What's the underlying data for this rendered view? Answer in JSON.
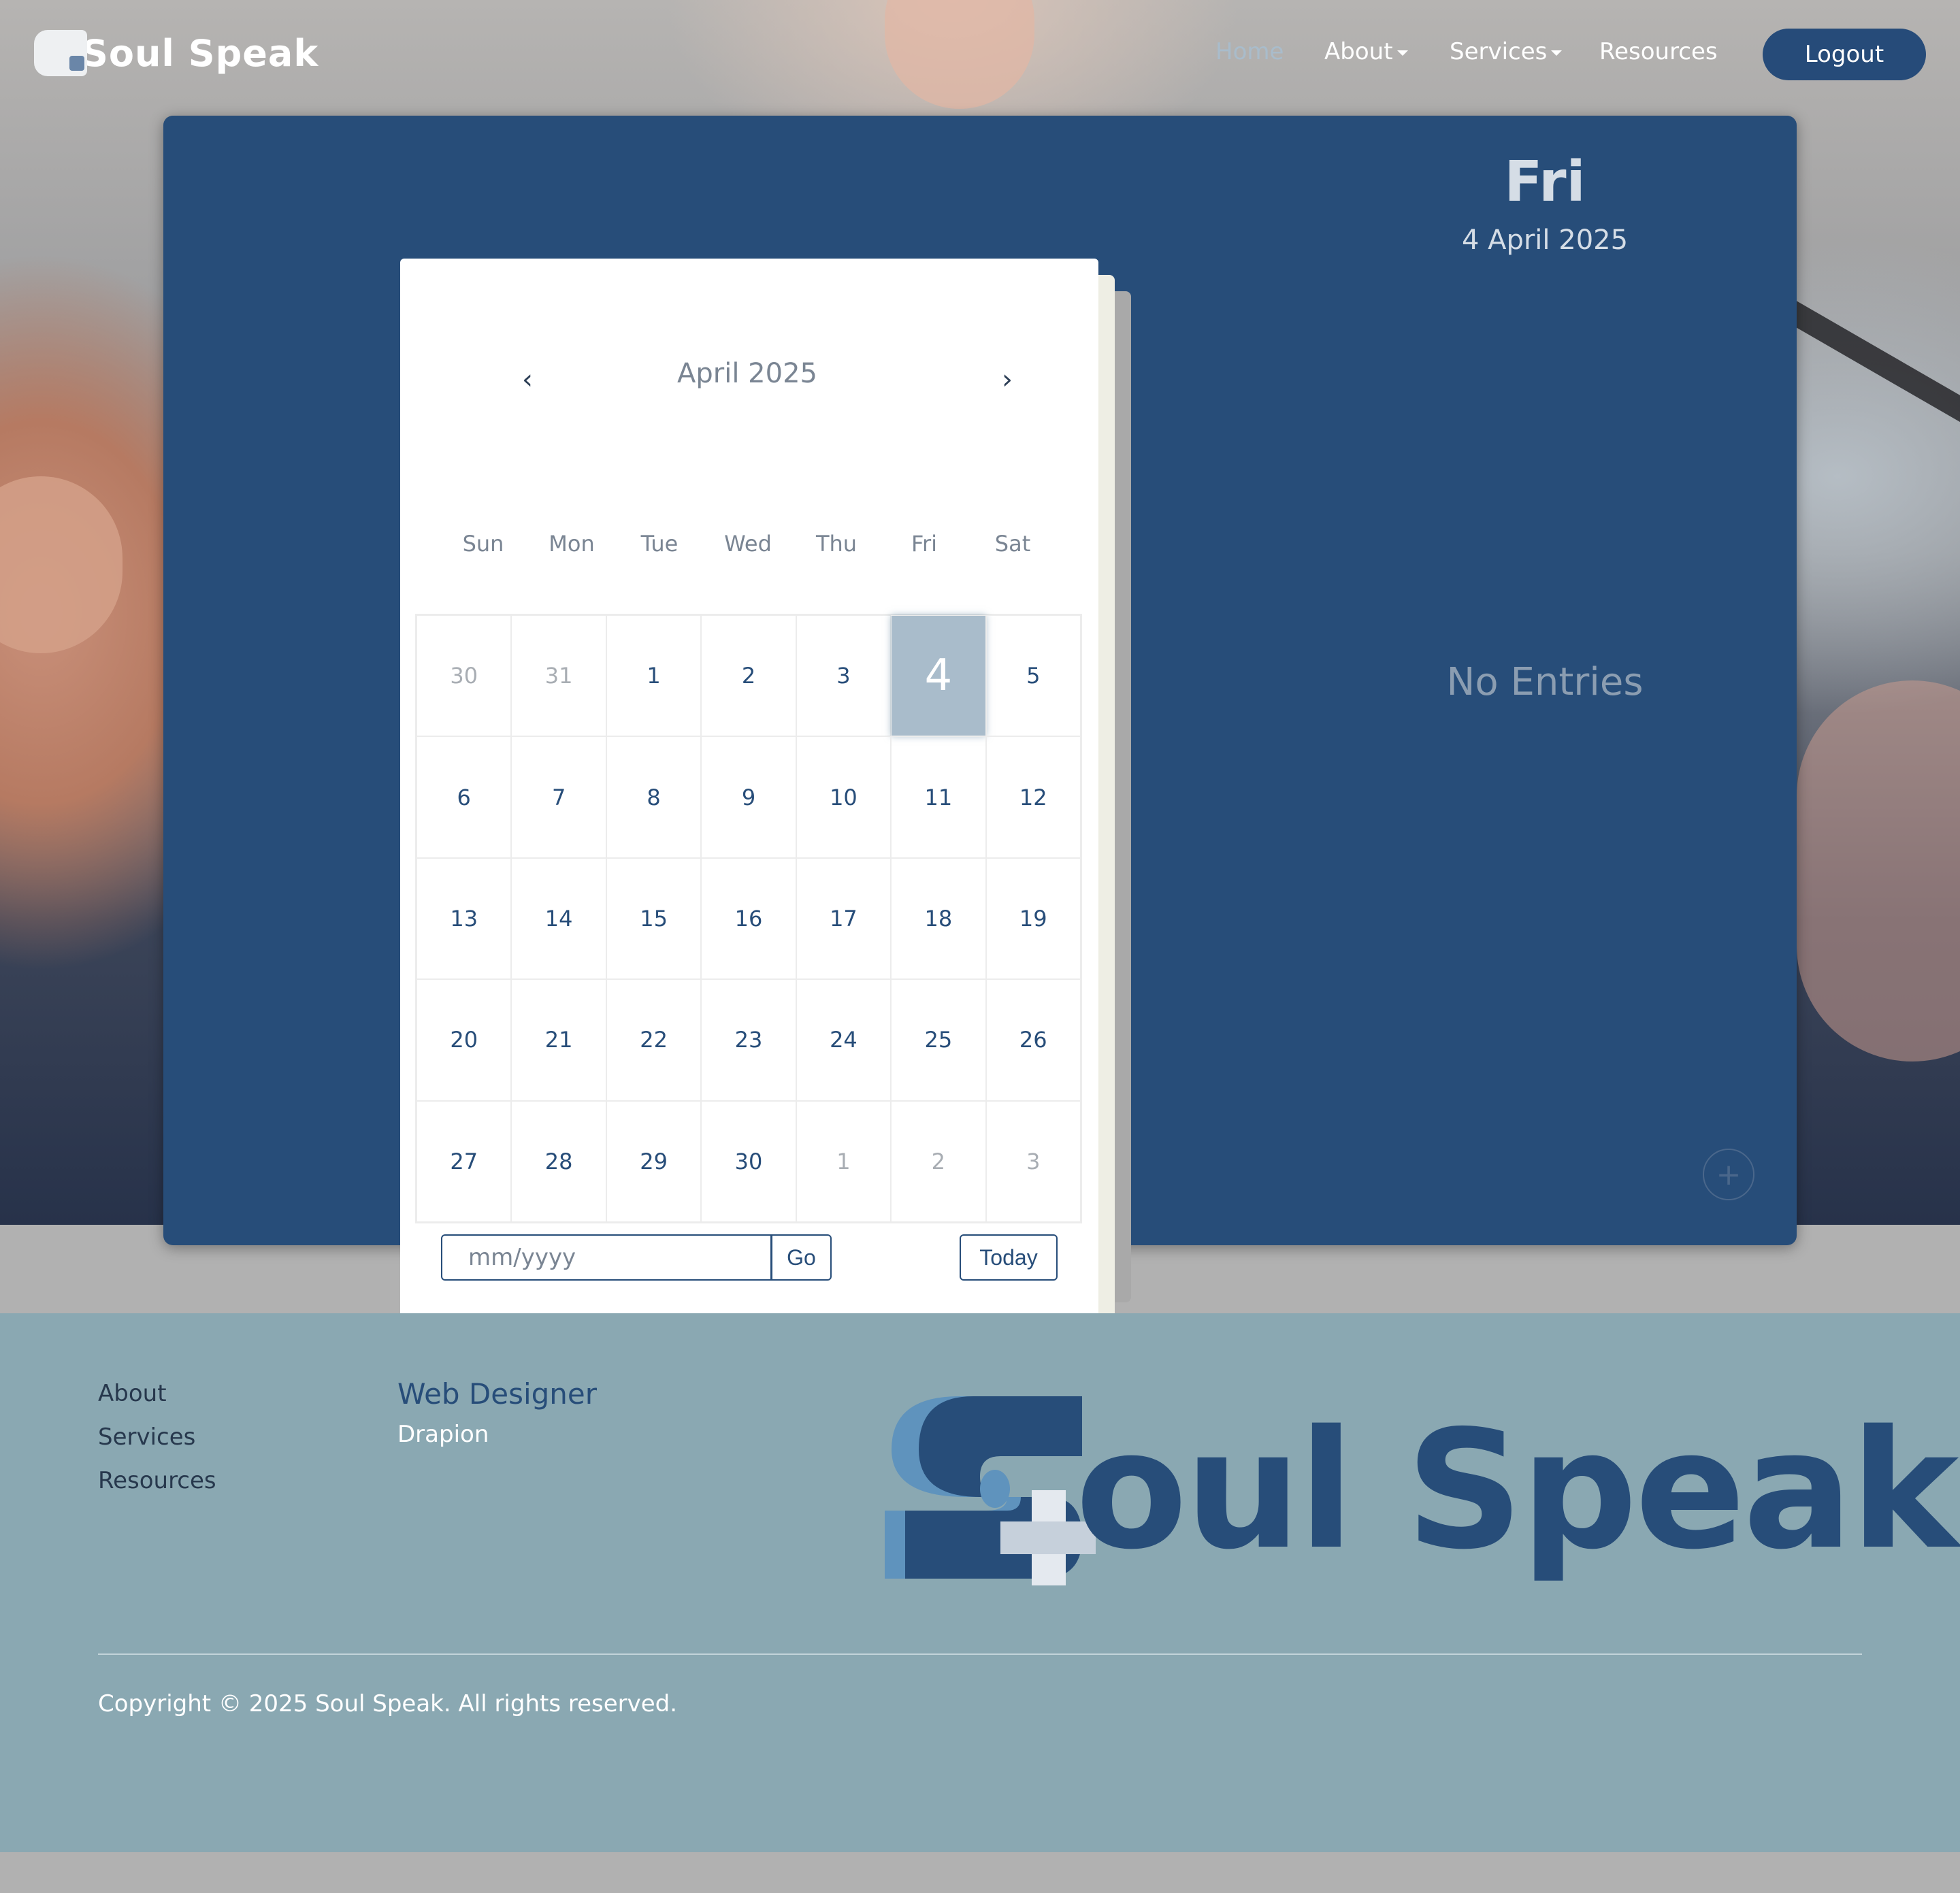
{
  "nav": {
    "brand": "Soul Speak",
    "links": [
      {
        "label": "Home",
        "active": true
      },
      {
        "label": "About",
        "dropdown": true
      },
      {
        "label": "Services",
        "dropdown": true
      },
      {
        "label": "Resources"
      }
    ],
    "logout_label": "Logout"
  },
  "calendar": {
    "prev_label": "‹",
    "next_label": "›",
    "month_title": "April 2025",
    "weekdays": [
      "Sun",
      "Mon",
      "Tue",
      "Wed",
      "Thu",
      "Fri",
      "Sat"
    ],
    "weeks": [
      [
        "30",
        "31",
        "1",
        "2",
        "3",
        "4",
        "5"
      ],
      [
        "6",
        "7",
        "8",
        "9",
        "10",
        "11",
        "12"
      ],
      [
        "13",
        "14",
        "15",
        "16",
        "17",
        "18",
        "19"
      ],
      [
        "20",
        "21",
        "22",
        "23",
        "24",
        "25",
        "26"
      ],
      [
        "27",
        "28",
        "29",
        "30",
        "1",
        "2",
        "3"
      ]
    ],
    "muted": [
      [
        0,
        0
      ],
      [
        0,
        1
      ],
      [
        4,
        4
      ],
      [
        4,
        5
      ],
      [
        4,
        6
      ]
    ],
    "selected": "4",
    "month_input_placeholder": "mm/yyyy",
    "go_label": "Go",
    "today_label": "Today"
  },
  "entry": {
    "day_name": "Fri",
    "full_date": "4 April 2025",
    "empty_text": "No Entries",
    "add_label": "+"
  },
  "footer": {
    "links": [
      "About",
      "Services",
      "Resources"
    ],
    "credit_role": "Web Designer",
    "credit_name": "Drapion",
    "logo_text": "oul Speak",
    "copyright": "Copyright © 2025 Soul Speak. All rights reserved."
  },
  "colors": {
    "primary": "#274d79",
    "selected_day": "#a9bccb",
    "footer_bg": "#8aa8b2",
    "page_bg": "#b1b1b1"
  }
}
